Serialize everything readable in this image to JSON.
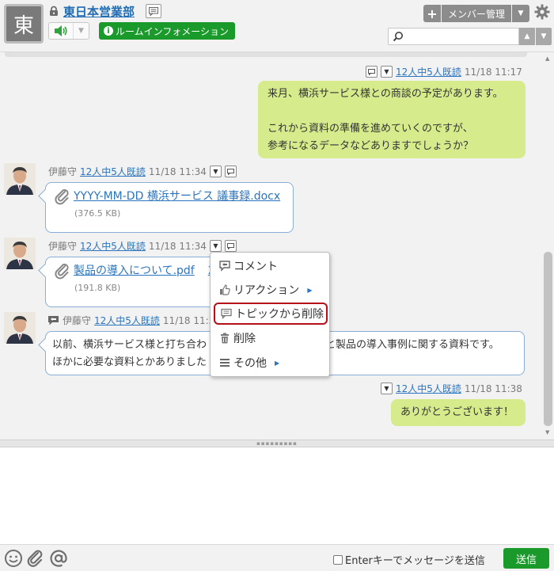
{
  "header": {
    "avatar_char": "東",
    "room_name": "東日本営業部",
    "room_info_label": "ルームインフォメーション",
    "member_manage_label": "メンバー管理",
    "search_placeholder": "",
    "room_info_icon": "i"
  },
  "messages": [
    {
      "id": "m1",
      "mine": true,
      "read_status": "12人中5人既読",
      "time": "11/18 11:17",
      "text": "来月、横浜サービス様との商談の予定があります。\n\nこれから資料の準備を進めていくのですが、\n参考になるデータなどありますでしょうか？"
    },
    {
      "id": "m2",
      "mine": false,
      "sender": "伊藤守",
      "read_status": "12人中5人既読",
      "time": "11/18 11:34",
      "file_name": "YYYY-MM-DD 横浜サービス 議事録.docx",
      "file_size": "(376.5 KB)"
    },
    {
      "id": "m3",
      "mine": false,
      "sender": "伊藤守",
      "read_status": "12人中5人既読",
      "time": "11/18 11:34",
      "file_name": "製品の導入について.pdf",
      "file_extra": "2",
      "file_size": "(191.8 KB)"
    },
    {
      "id": "m4",
      "mine": false,
      "sender": "伊藤守",
      "read_status": "12人中5人既読",
      "time": "11/18 11:37",
      "line1_a": "以前、横浜サービス様と打ち合わ",
      "line1_b": "と製品の導入事例に関する資料です。",
      "line2": "ほかに必要な資料とかありました"
    },
    {
      "id": "m5",
      "mine": true,
      "read_status": "12人中5人既読",
      "time": "11/18 11:38",
      "text": "ありがとうございます！"
    }
  ],
  "context_menu": {
    "items": [
      {
        "label": "コメント",
        "icon": "comment-icon"
      },
      {
        "label": "リアクション",
        "icon": "thumbs-up-icon",
        "submenu": true
      },
      {
        "label": "トピックから削除",
        "icon": "topic-icon",
        "highlighted": true
      },
      {
        "label": "削除",
        "icon": "trash-icon"
      },
      {
        "label": "その他",
        "icon": "menu-lines-icon",
        "submenu": true
      }
    ]
  },
  "footer": {
    "enter_send_label": "Enterキーでメッセージを送信",
    "send_label": "送信"
  },
  "colors": {
    "green": "#1a9a2b",
    "mine_bubble": "#d6ec8c",
    "link": "#2a74c0",
    "highlight_border": "#b3101a"
  }
}
